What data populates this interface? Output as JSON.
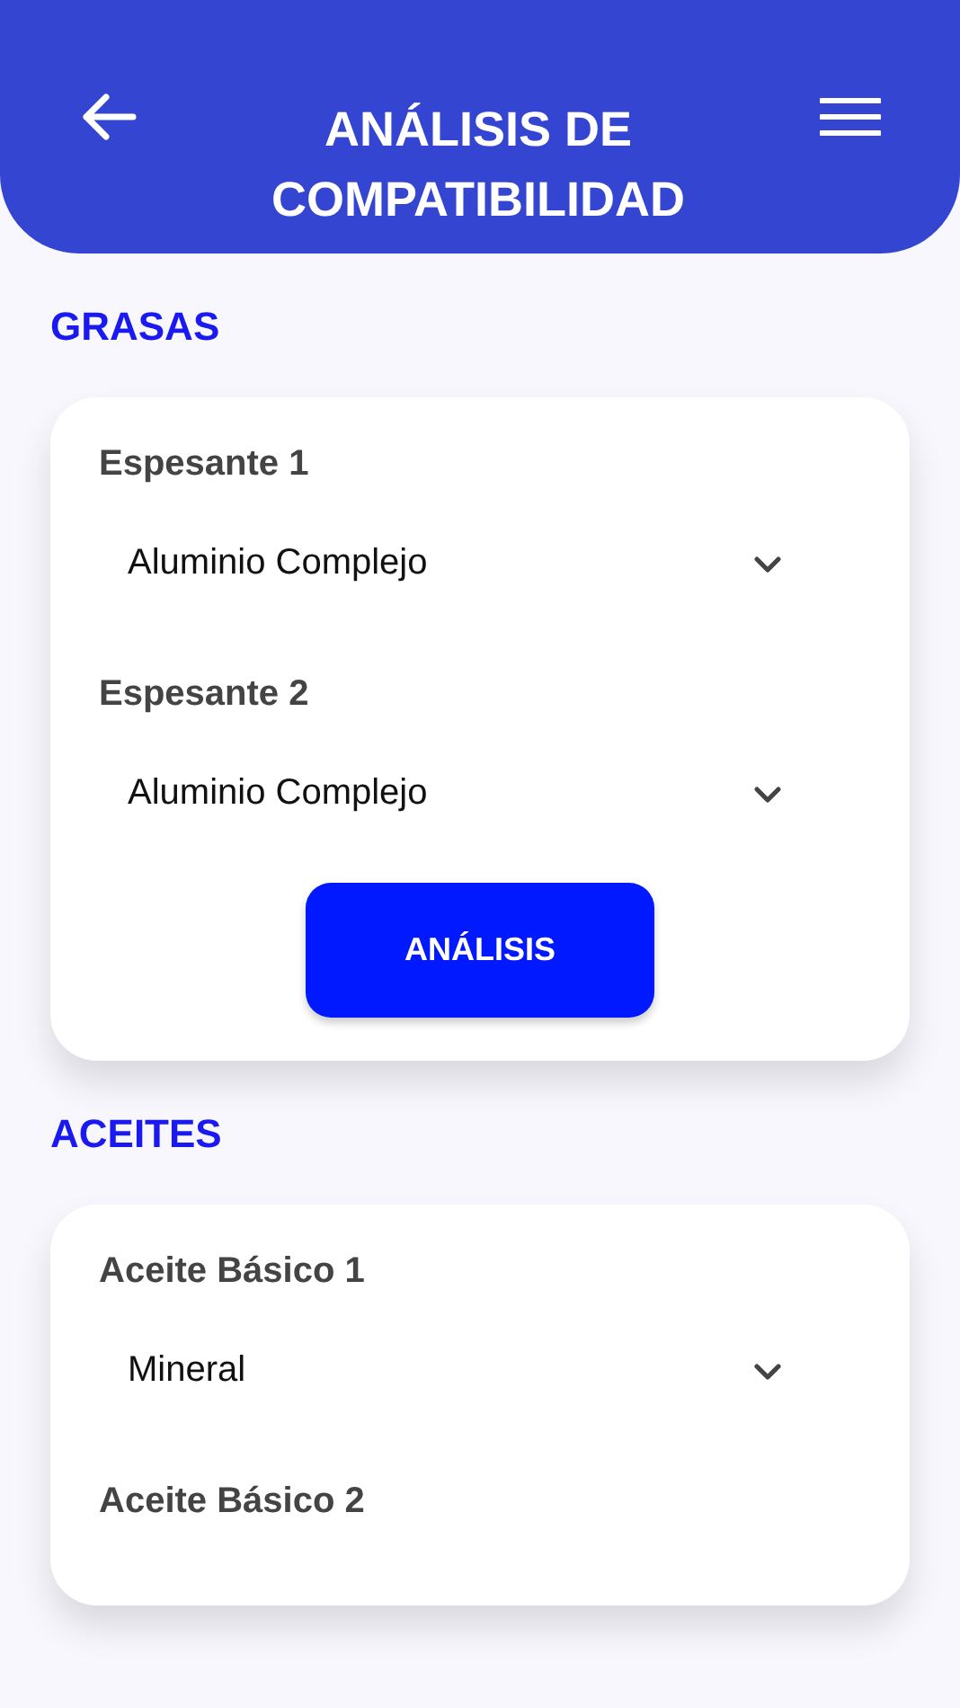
{
  "header": {
    "title": "ANÁLISIS DE COMPATIBILIDAD"
  },
  "sections": [
    {
      "title": "GRASAS",
      "fields": [
        {
          "label": "Espesante 1",
          "value": "Aluminio Complejo"
        },
        {
          "label": "Espesante 2",
          "value": "Aluminio Complejo"
        }
      ],
      "button": "ANÁLISIS"
    },
    {
      "title": "ACEITES",
      "fields": [
        {
          "label": "Aceite Básico 1",
          "value": "Mineral"
        },
        {
          "label": "Aceite Básico 2"
        }
      ]
    }
  ]
}
